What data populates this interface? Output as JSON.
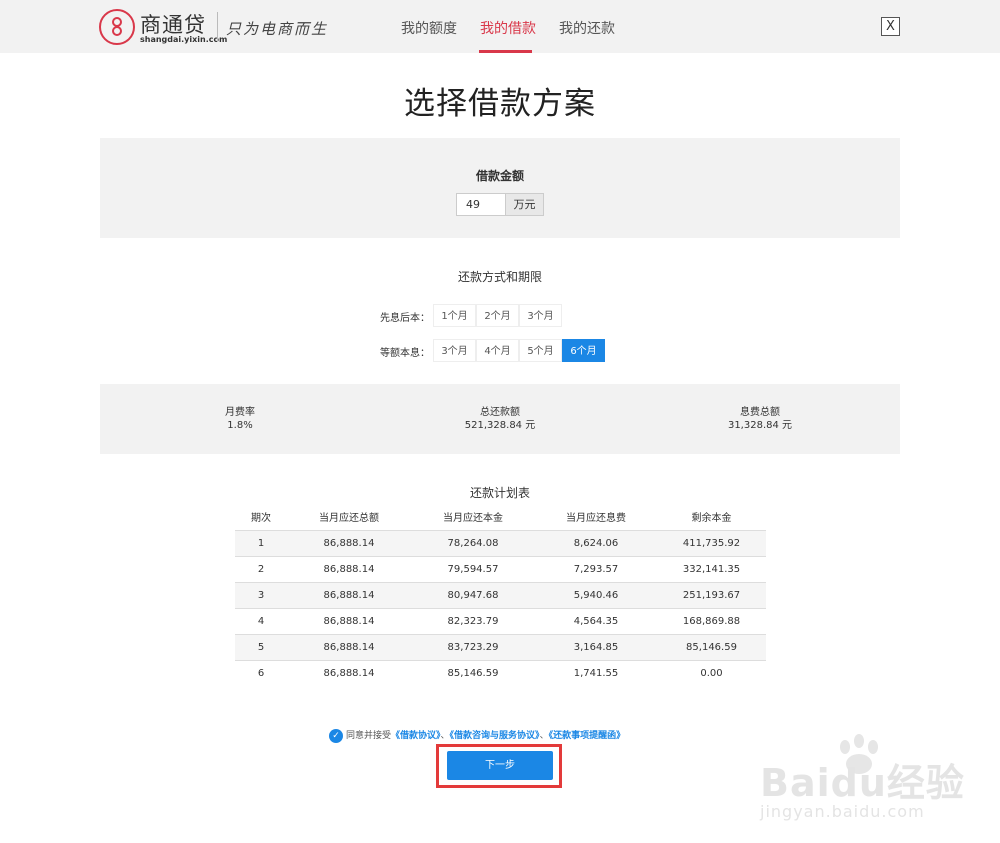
{
  "header": {
    "logo_name": "商通贷",
    "logo_domain": "shangdai.yixin.com",
    "slogan": "只为电商而生",
    "nav": [
      "我的额度",
      "我的借款",
      "我的还款"
    ],
    "close_label": "X"
  },
  "page_title": "选择借款方案",
  "amount": {
    "label": "借款金额",
    "value": "49",
    "unit": "万元"
  },
  "repayment": {
    "title": "还款方式和期限",
    "groups": [
      {
        "label": "先息后本：",
        "options": [
          "1个月",
          "2个月",
          "3个月"
        ]
      },
      {
        "label": "等额本息：",
        "options": [
          "3个月",
          "4个月",
          "5个月",
          "6个月"
        ]
      }
    ],
    "selected": "6个月"
  },
  "summary": [
    {
      "label": "月费率",
      "value": "1.8%"
    },
    {
      "label": "总还款额",
      "value": "521,328.84 元"
    },
    {
      "label": "息费总额",
      "value": "31,328.84 元"
    }
  ],
  "schedule": {
    "title": "还款计划表",
    "columns": [
      "期次",
      "当月应还总额",
      "当月应还本金",
      "当月应还息费",
      "剩余本金"
    ],
    "rows": [
      [
        "1",
        "86,888.14",
        "78,264.08",
        "8,624.06",
        "411,735.92"
      ],
      [
        "2",
        "86,888.14",
        "79,594.57",
        "7,293.57",
        "332,141.35"
      ],
      [
        "3",
        "86,888.14",
        "80,947.68",
        "5,940.46",
        "251,193.67"
      ],
      [
        "4",
        "86,888.14",
        "82,323.79",
        "4,564.35",
        "168,869.88"
      ],
      [
        "5",
        "86,888.14",
        "83,723.29",
        "3,164.85",
        "85,146.59"
      ],
      [
        "6",
        "86,888.14",
        "85,146.59",
        "1,741.55",
        "0.00"
      ]
    ]
  },
  "agreement": {
    "prefix": "同意并接受",
    "links": [
      "《借款协议》",
      "《借款咨询与服务协议》",
      "《还款事项提醒函》"
    ],
    "separator": "、"
  },
  "next_button": "下一步",
  "watermark": {
    "brand": "Baidu经验",
    "url": "jingyan.baidu.com"
  },
  "colors": {
    "accent": "#d9384a",
    "primary": "#1b87e5",
    "highlight": "#e33a3a"
  }
}
